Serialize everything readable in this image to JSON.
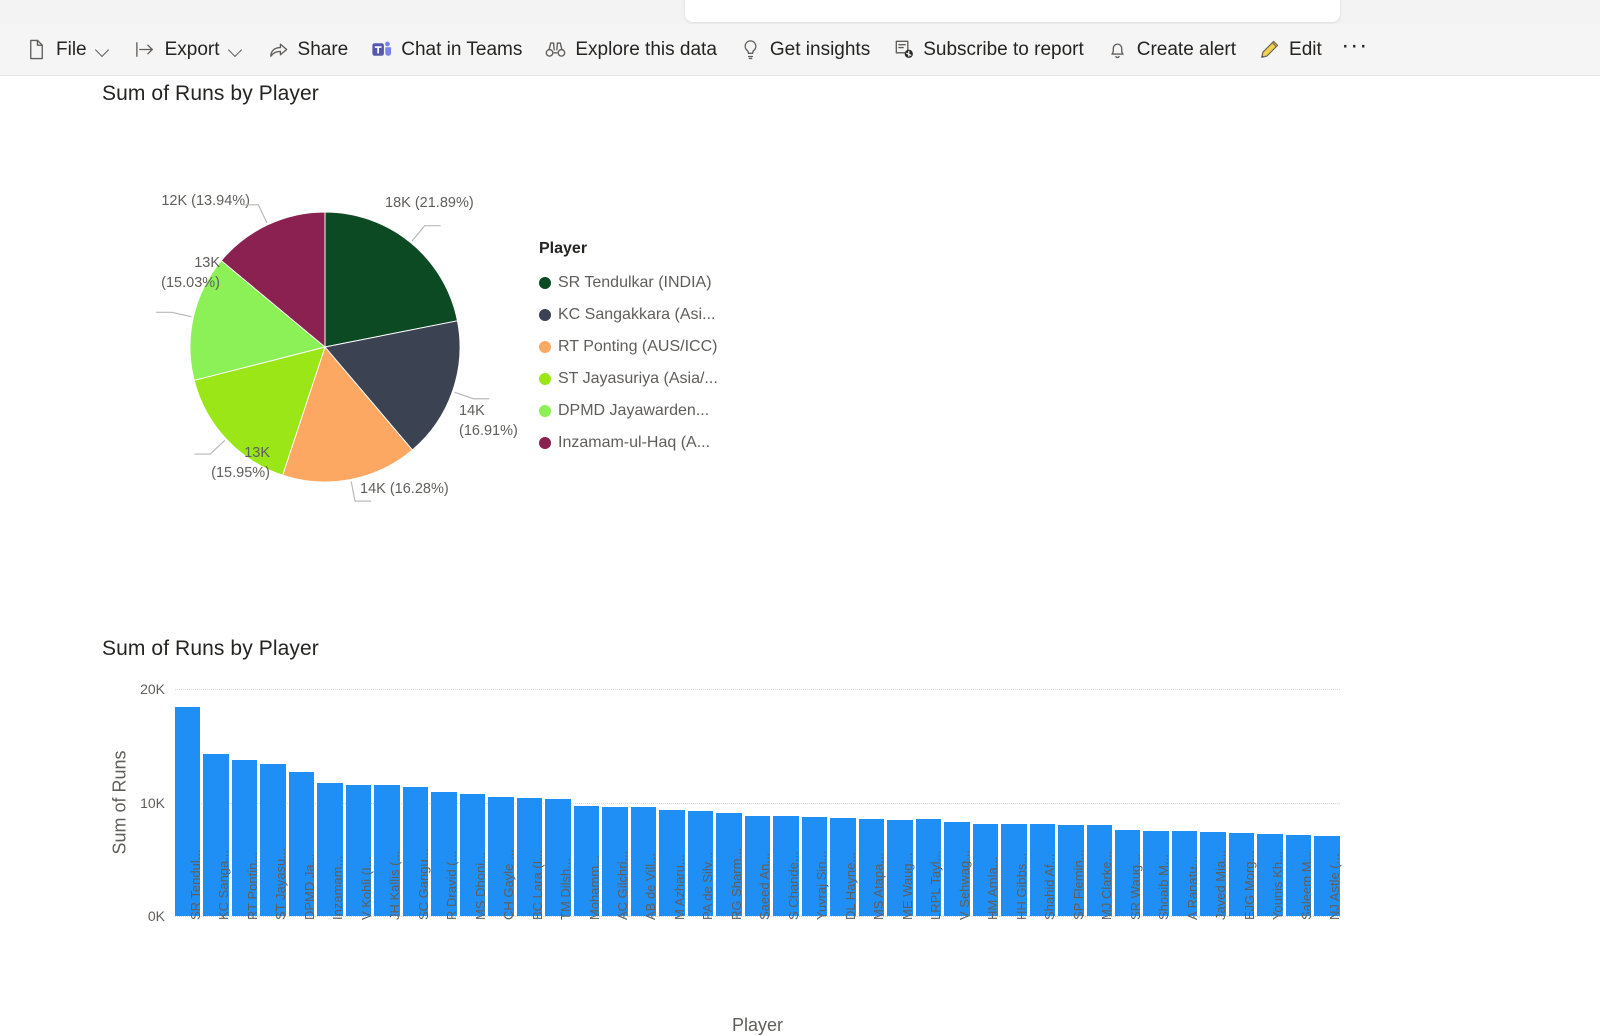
{
  "command_bar": {
    "items": [
      {
        "id": "file",
        "label": "File",
        "icon": "document-icon",
        "has_chevron": true
      },
      {
        "id": "export",
        "label": "Export",
        "icon": "export-icon",
        "has_chevron": true
      },
      {
        "id": "share",
        "label": "Share",
        "icon": "share-icon",
        "has_chevron": false
      },
      {
        "id": "chat-teams",
        "label": "Chat in Teams",
        "icon": "teams-icon",
        "has_chevron": false
      },
      {
        "id": "explore",
        "label": "Explore this data",
        "icon": "binoculars-icon",
        "has_chevron": false
      },
      {
        "id": "insights",
        "label": "Get insights",
        "icon": "lightbulb-icon",
        "has_chevron": false
      },
      {
        "id": "subscribe",
        "label": "Subscribe to report",
        "icon": "subscribe-icon",
        "has_chevron": false
      },
      {
        "id": "alert",
        "label": "Create alert",
        "icon": "bell-icon",
        "has_chevron": false
      },
      {
        "id": "edit",
        "label": "Edit",
        "icon": "pencil-icon",
        "has_chevron": false
      }
    ],
    "overflow_label": "···"
  },
  "pie_visual": {
    "title": "Sum of Runs by Player",
    "legend_title": "Player"
  },
  "bar_visual": {
    "title": "Sum of Runs by Player"
  },
  "chart_data": [
    {
      "type": "pie",
      "title": "Sum of Runs by Player",
      "legend_title": "Player",
      "legend_position": "right",
      "slices": [
        {
          "label": "SR Tendulkar (INDIA)",
          "legend_label": "SR Tendulkar (INDIA)",
          "value": 18426,
          "value_text": "18K",
          "percent": 21.89,
          "callout": "18K (21.89%)",
          "color": "#0b4a23"
        },
        {
          "label": "KC Sangakkara (Asia/ICC/SL)",
          "legend_label": "KC Sangakkara (Asi...",
          "value": 14234,
          "value_text": "14K",
          "percent": 16.91,
          "callout": "14K (16.91%)",
          "color": "#3b4252"
        },
        {
          "label": "RT Ponting (AUS/ICC)",
          "legend_label": "RT Ponting (AUS/ICC)",
          "value": 13704,
          "value_text": "14K",
          "percent": 16.28,
          "callout": "14K (16.28%)",
          "color": "#fca863"
        },
        {
          "label": "ST Jayasuriya (Asia/SL)",
          "legend_label": "ST Jayasuriya (Asia/...",
          "value": 13430,
          "value_text": "13K",
          "percent": 15.95,
          "callout": "13K (15.95%)",
          "color": "#9ae616"
        },
        {
          "label": "DPMD Jayawardene (Asia/SL)",
          "legend_label": "DPMD Jayawarden...",
          "value": 12650,
          "value_text": "13K",
          "percent": 15.03,
          "callout": "13K (15.03%)",
          "color": "#8cf057"
        },
        {
          "label": "Inzamam-ul-Haq (ASIA/PAK)",
          "legend_label": "Inzamam-ul-Haq (A...",
          "value": 11739,
          "value_text": "12K",
          "percent": 13.94,
          "callout": "12K (13.94%)",
          "color": "#8a2150"
        }
      ]
    },
    {
      "type": "bar",
      "title": "Sum of Runs by Player",
      "xlabel": "Player",
      "ylabel": "Sum of Runs",
      "ylim": [
        0,
        20000
      ],
      "yticks": [
        {
          "value": 0,
          "label": "0K"
        },
        {
          "value": 10000,
          "label": "10K"
        },
        {
          "value": 20000,
          "label": "20K"
        }
      ],
      "grid": true,
      "bar_color": "#1f8ff5",
      "categories": [
        "SR Tendul...",
        "KC Sanga...",
        "RT Pontin...",
        "ST Jayasu...",
        "DPMD Ja...",
        "Inzamam...",
        "V Kohli (I...",
        "JH Kallis (...",
        "SC Gangu...",
        "R Dravid (...",
        "MS Dhoni...",
        "CH Gayle ...",
        "BC Lara (I...",
        "TM Dilsh...",
        "Mohamm...",
        "AC Gilchri...",
        "AB de Vill...",
        "M Azharu...",
        "PA de Silv...",
        "RG Sharm...",
        "Saeed An...",
        "S Chande...",
        "Yuvraj Sin...",
        "DL Hayne...",
        "MS Atapa...",
        "ME Waug...",
        "LRPL Tayl...",
        "V Sehwag...",
        "HM Amla...",
        "HH Gibbs...",
        "Shahid Af...",
        "SP Flemin...",
        "MJ Clarke...",
        "SR Waug...",
        "Shoaib M...",
        "A Ranatu...",
        "Javed Mia...",
        "EJG Morg...",
        "Younis Kh...",
        "Saleem M...",
        "NJ Astle (..."
      ],
      "values": [
        18426,
        14234,
        13704,
        13430,
        12650,
        11739,
        11520,
        11579,
        11363,
        10889,
        10773,
        10480,
        10405,
        10290,
        9720,
        9619,
        9577,
        9378,
        9284,
        9115,
        8824,
        8778,
        8701,
        8648,
        8529,
        8500,
        8581,
        8273,
        8113,
        8094,
        8064,
        8037,
        7981,
        7569,
        7534,
        7456,
        7381,
        7330,
        7249,
        7142,
        7090
      ]
    }
  ]
}
